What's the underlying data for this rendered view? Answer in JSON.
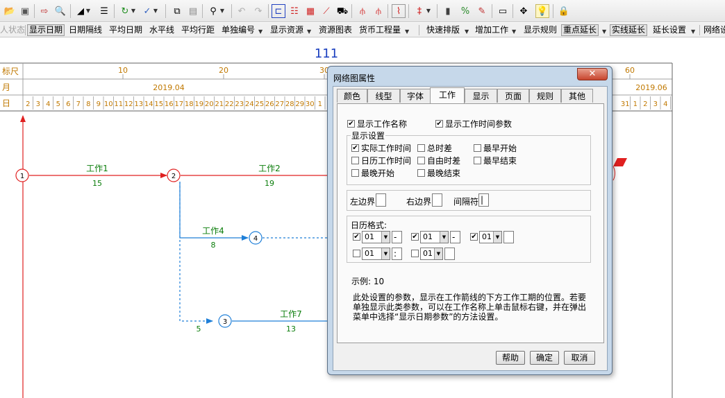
{
  "toolbar2": {
    "items": [
      "人状态",
      "显示日期",
      "日期隔线",
      "平均日期",
      "水平线",
      "平均行距",
      "单独编号",
      "显示资源",
      "资源图表",
      "货币工程量",
      "快速排版",
      "增加工作",
      "显示规则",
      "重点延长",
      "实线延长",
      "延长设置",
      "网络设"
    ]
  },
  "chart": {
    "title": "111",
    "row_labels": {
      "ruler": "标尺",
      "month": "月",
      "day": "日"
    },
    "ruler_ticks": [
      "10",
      "20",
      "30",
      "60"
    ],
    "months": [
      "2019.04",
      "2019.06"
    ],
    "days": [
      "2",
      "3",
      "4",
      "5",
      "6",
      "7",
      "8",
      "9",
      "10",
      "11",
      "12",
      "13",
      "14",
      "15",
      "16",
      "17",
      "18",
      "19",
      "20",
      "21",
      "22",
      "23",
      "24",
      "25",
      "26",
      "27",
      "28",
      "29",
      "30",
      "1"
    ],
    "days_right": [
      "31",
      "1",
      "2",
      "3",
      "4"
    ],
    "nodes": [
      "1",
      "2",
      "4",
      "3"
    ],
    "activities": [
      {
        "name": "工作1",
        "duration": "15"
      },
      {
        "name": "工作2",
        "duration": "19"
      },
      {
        "name": "工作4",
        "duration": "8"
      },
      {
        "name": "",
        "duration": "5"
      },
      {
        "name": "工作7",
        "duration": "13"
      }
    ],
    "colors": {
      "critical": "#e02020",
      "normal": "#1f7fd8",
      "text": "#0a7d0a",
      "title": "#1a3fbf"
    }
  },
  "dialog": {
    "title": "网络图属性",
    "close": "✕",
    "tabs": [
      "颜色",
      "线型",
      "字体",
      "工作",
      "显示",
      "页面",
      "规则",
      "其他"
    ],
    "selected_tab": "工作",
    "show_name": {
      "label": "显示工作名称",
      "checked": true
    },
    "show_time_params": {
      "label": "显示工作时间参数",
      "checked": true
    },
    "display_group": {
      "title": "显示设置",
      "options": [
        {
          "label": "实际工作时间",
          "checked": true
        },
        {
          "label": "总时差",
          "checked": false
        },
        {
          "label": "最早开始",
          "checked": false
        },
        {
          "label": "日历工作时间",
          "checked": false
        },
        {
          "label": "自由时差",
          "checked": false
        },
        {
          "label": "最早结束",
          "checked": false
        },
        {
          "label": "最晚开始",
          "checked": false
        },
        {
          "label": "最晚结束",
          "checked": false
        }
      ]
    },
    "border": {
      "left_label": "左边界",
      "left_value": "",
      "right_label": "右边界",
      "right_value": "",
      "sep_label": "间隔符",
      "sep_value": "|"
    },
    "calendar": {
      "title": "日历格式:",
      "row1": [
        {
          "checked": true,
          "value": "01",
          "sep": "-"
        },
        {
          "checked": true,
          "value": "01",
          "sep": "-"
        },
        {
          "checked": true,
          "value": "01",
          "sep": ""
        }
      ],
      "row2": [
        {
          "checked": false,
          "value": "01",
          "sep": ":"
        },
        {
          "checked": false,
          "value": "01",
          "sep": ""
        }
      ]
    },
    "example": "示例: 10",
    "note": "此处设置的参数，显示在工作箭线的下方工作工期的位置。若要单独显示此类参数，可以在工作名称上单击鼠标右键，并在弹出菜单中选择“显示日期参数”的方法设置。",
    "buttons": {
      "help": "帮助",
      "ok": "确定",
      "cancel": "取消"
    }
  }
}
